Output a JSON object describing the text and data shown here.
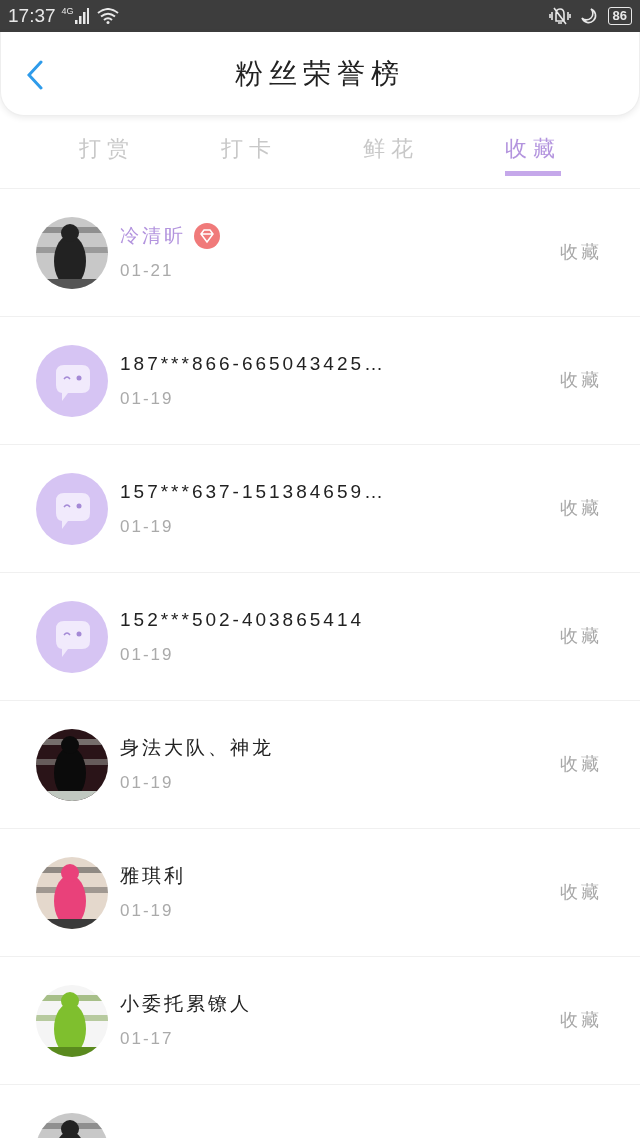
{
  "status_bar": {
    "time": "17:37",
    "network": "4G",
    "battery": "86"
  },
  "header": {
    "title": "粉丝荣誉榜"
  },
  "tabs": [
    {
      "label": "打赏",
      "selected": false
    },
    {
      "label": "打卡",
      "selected": false
    },
    {
      "label": "鲜花",
      "selected": false
    },
    {
      "label": "收藏",
      "selected": true
    }
  ],
  "rows": [
    {
      "kind": "picture",
      "name": "冷清昕",
      "vip": true,
      "date": "01-21",
      "action": "收藏"
    },
    {
      "kind": "default",
      "name": "187***866-665043425…",
      "vip": false,
      "date": "01-19",
      "action": "收藏"
    },
    {
      "kind": "default",
      "name": "157***637-151384659…",
      "vip": false,
      "date": "01-19",
      "action": "收藏"
    },
    {
      "kind": "default",
      "name": "152***502-403865414",
      "vip": false,
      "date": "01-19",
      "action": "收藏"
    },
    {
      "kind": "picture",
      "name": "身法大队、神龙",
      "vip": false,
      "date": "01-19",
      "action": "收藏"
    },
    {
      "kind": "picture",
      "name": "雅琪利",
      "vip": false,
      "date": "01-19",
      "action": "收藏"
    },
    {
      "kind": "picture",
      "name": "小委托累镣人",
      "vip": false,
      "date": "01-17",
      "action": "收藏"
    },
    {
      "kind": "picture"
    }
  ]
}
